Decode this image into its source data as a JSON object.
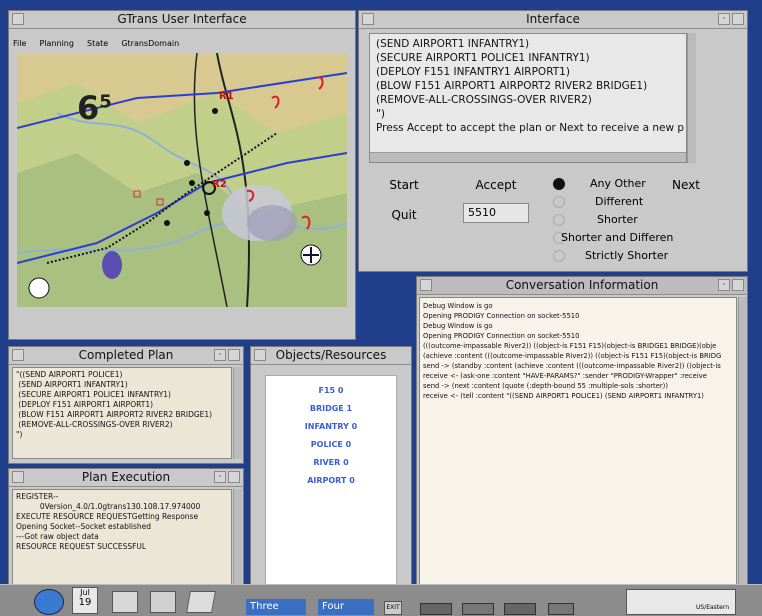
{
  "gtrans": {
    "title": "GTrans User Interface",
    "menu": [
      "File",
      "Planning",
      "State",
      "GtransDomain"
    ],
    "map": {
      "zone_label": "6",
      "zone_sup": "5",
      "r1": "R1",
      "r2": "R2"
    }
  },
  "interface": {
    "title": "Interface",
    "lines": [
      "(SEND AIRPORT1 INFANTRY1)",
      "(SECURE AIRPORT1 POLICE1 INFANTRY1)",
      "(DEPLOY F151 INFANTRY1 AIRPORT1)",
      "(BLOW F151 AIRPORT1 AIRPORT2 RIVER2 BRIDGE1)",
      "(REMOVE-ALL-CROSSINGS-OVER RIVER2)",
      "\")",
      "Press Accept to accept the plan or Next to receive a new p"
    ],
    "buttons": {
      "start": "Start",
      "accept": "Accept",
      "next": "Next",
      "quit": "Quit"
    },
    "number_value": "5510",
    "options": [
      "Any Other",
      "Different",
      "Shorter",
      "Shorter and Differen",
      "Strictly Shorter"
    ]
  },
  "conversation": {
    "title": "Conversation Information",
    "lines": [
      "Debug Window is go",
      "Opening PRODIGY Connection on socket-5510",
      "Debug Window is go",
      "Opening PRODIGY Connection on socket-5510",
      "(((outcome-impassable River2)) ((object-is F151 F15)(object-is BRIDGE1 BRIDGE)(obje",
      "(achieve :content (((outcome-impassable River2)) ((object-is F151 F15)(object-is BRIDG",
      "send -> (standby :content (achieve :content (((outcome-impassable River2)) ((object-is",
      "receive <- (ask-one :content \"HAVE-PARAMS?\" :sender \"PRODIGY-Wrapper\" :receive",
      "send -> (next :content (quote (:depth-bound 55 :multiple-sols :shorter))",
      "receive <- (tell :content \"((SEND AIRPORT1 POLICE1) (SEND AIRPORT1 INFANTRY1)"
    ]
  },
  "completed_plan": {
    "title": "Completed Plan",
    "lines": [
      "\"((SEND AIRPORT1 POLICE1)",
      " (SEND AIRPORT1 INFANTRY1)",
      " (SECURE AIRPORT1 POLICE1 INFANTRY1)",
      " (DEPLOY F151 AIRPORT1 AIRPORT1)",
      " (BLOW F151 AIRPORT1 AIRPORT2 RIVER2 BRIDGE1)",
      " (REMOVE-ALL-CROSSINGS-OVER RIVER2)",
      "\")"
    ]
  },
  "objects": {
    "title": "Objects/Resources",
    "items": [
      "F15 0",
      "BRIDGE 1",
      "INFANTRY 0",
      "POLICE 0",
      "RIVER 0",
      "AIRPORT 0"
    ]
  },
  "plan_execution": {
    "title": "Plan Execution",
    "lines": [
      "REGISTER--",
      "          0Version_4.0/1.0gtrans130.108.17.974000",
      "EXECUTE RESOURCE REQUESTGetting Response",
      "Opening Socket--Socket established",
      "---Got raw object data",
      "RESOURCE REQUEST SUCCESSFUL"
    ]
  },
  "taskbar": {
    "calendar_month": "Jul",
    "calendar_day": "19",
    "workspace_three": "Three",
    "workspace_four": "Four",
    "exit_label": "EXIT",
    "clock": "US/Eastern"
  }
}
